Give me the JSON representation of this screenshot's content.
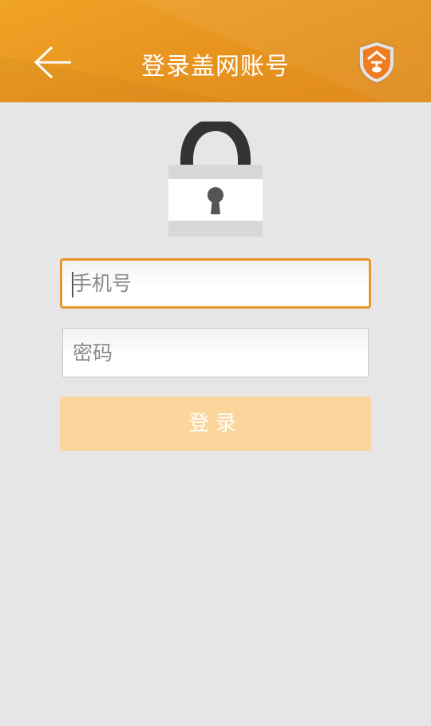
{
  "header": {
    "title": "登录盖网账号",
    "back_icon": "back-arrow-icon",
    "shield_icon": "shield-logo-icon",
    "background_color": "#e8951f"
  },
  "lock_icon": "padlock-icon",
  "form": {
    "phone": {
      "placeholder": "手机号",
      "value": ""
    },
    "password": {
      "placeholder": "密码",
      "value": ""
    },
    "login_label": "登录",
    "accent_color": "#e99528",
    "button_color": "#fad69c"
  }
}
